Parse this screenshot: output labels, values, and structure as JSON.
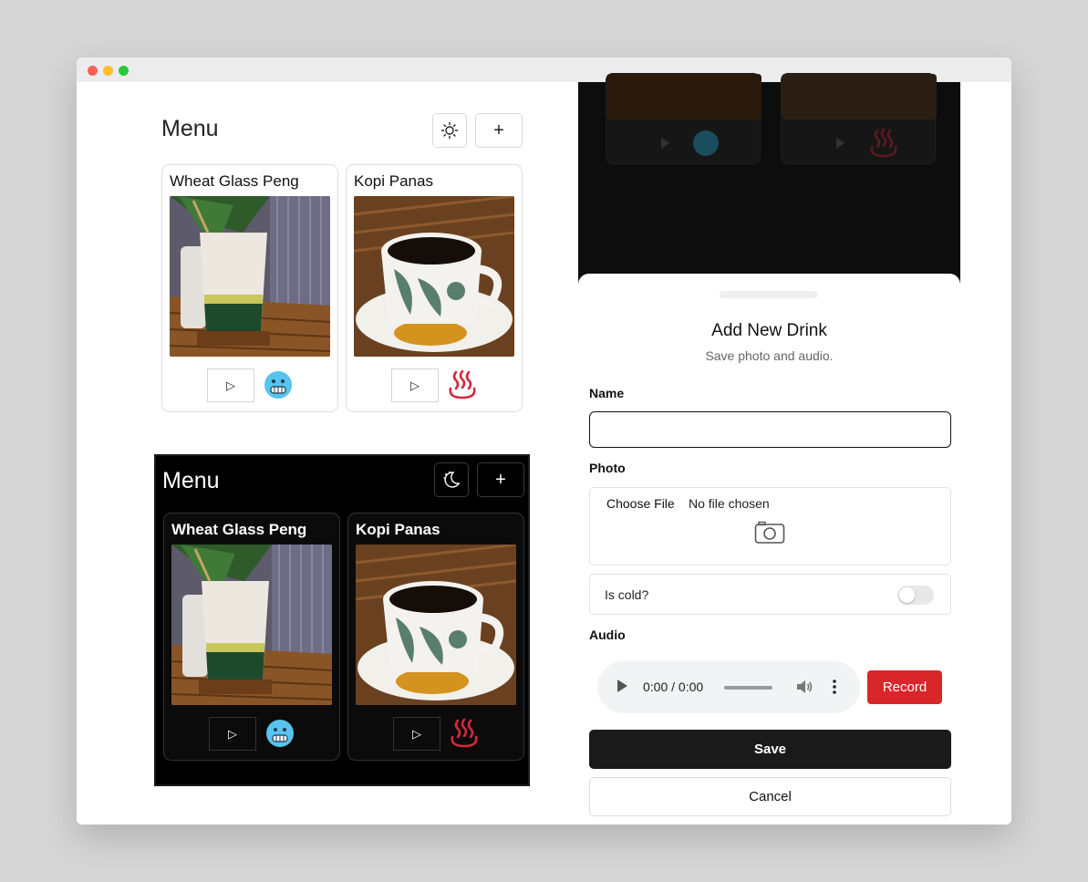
{
  "light_menu": {
    "title": "Menu",
    "theme_icon": "sun-icon",
    "add_label": "+",
    "cards": [
      {
        "title": "Wheat Glass Peng",
        "temp_icon": "cold-face-icon",
        "play_label": "▷"
      },
      {
        "title": "Kopi Panas",
        "temp_icon": "hot-springs-icon",
        "play_label": "▷"
      }
    ]
  },
  "dark_menu": {
    "title": "Menu",
    "theme_icon": "moon-icon",
    "add_label": "+",
    "cards": [
      {
        "title": "Wheat Glass Peng",
        "temp_icon": "cold-face-icon",
        "play_label": "▷"
      },
      {
        "title": "Kopi Panas",
        "temp_icon": "hot-springs-icon",
        "play_label": "▷"
      }
    ]
  },
  "sheet": {
    "title": "Add New Drink",
    "subtitle": "Save photo and audio.",
    "name_label": "Name",
    "name_value": "",
    "photo_label": "Photo",
    "choose_file": "Choose File",
    "file_status": "No file chosen",
    "is_cold_label": "Is cold?",
    "is_cold": false,
    "audio_label": "Audio",
    "audio_time": "0:00 / 0:00",
    "record_label": "Record",
    "save_label": "Save",
    "cancel_label": "Cancel"
  },
  "colors": {
    "record": "#d9262b",
    "save": "#1a1a1a",
    "hot": "#d6283a",
    "cold": "#58c3ee"
  }
}
